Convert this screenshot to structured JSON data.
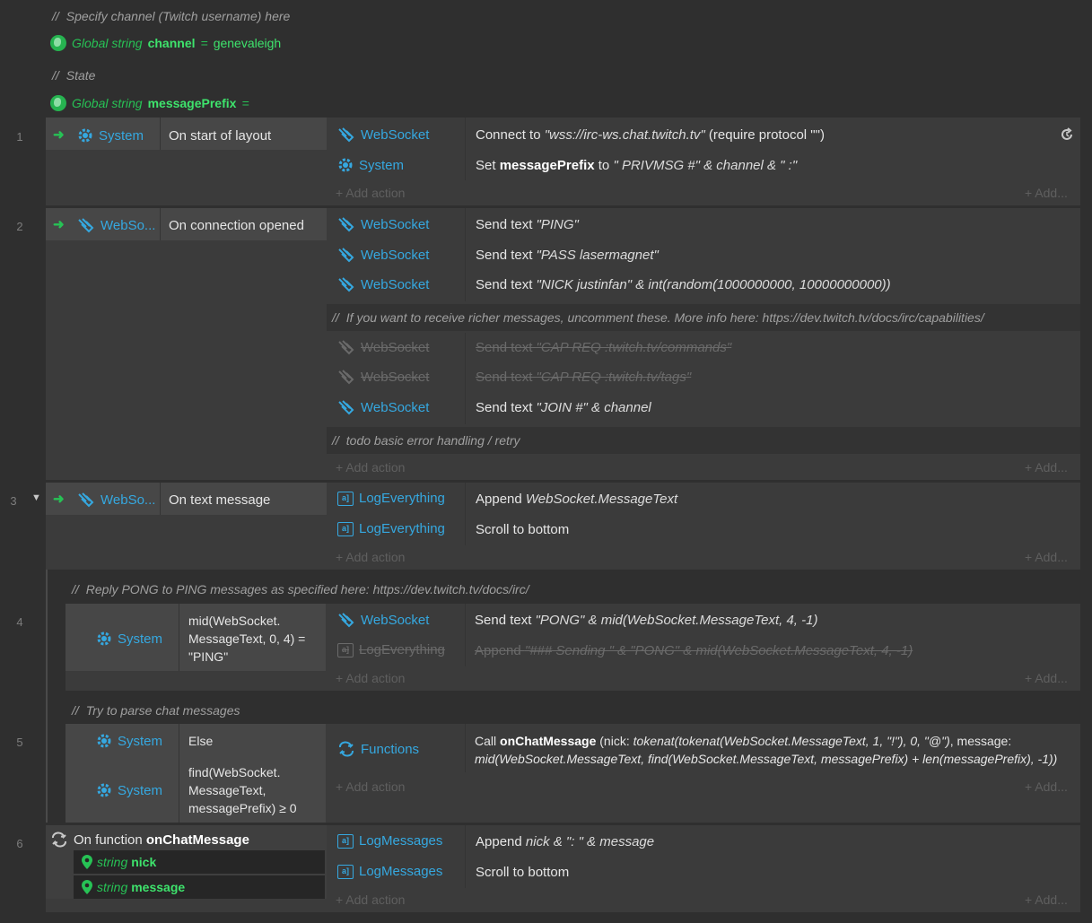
{
  "comments": {
    "channel": "Specify channel (Twitch username) here",
    "state": "State",
    "richer": "If you want to receive richer messages, uncomment these. More info here: https://dev.twitch.tv/docs/irc/capabilities/",
    "todo": "todo basic error handling / retry",
    "pong": "Reply PONG to PING messages as specified here: https://dev.twitch.tv/docs/irc/",
    "parse": "Try to parse chat messages",
    "slash": "//"
  },
  "globals": {
    "kw": "Global string",
    "channel_name": "channel",
    "channel_eq": "=",
    "channel_value": "genevaleigh",
    "prefix_name": "messagePrefix",
    "prefix_eq": "="
  },
  "line_numbers": [
    "1",
    "2",
    "3",
    "4",
    "5",
    "6"
  ],
  "add_action": "+ Add action",
  "add": "+ Add...",
  "events": {
    "e1": {
      "obj": "System",
      "cond": "On start of layout",
      "actions": [
        {
          "obj": "WebSocket",
          "pre": "Connect to ",
          "italic": "\"wss://irc-ws.chat.twitch.tv\"",
          "post": " (require protocol \"\")"
        },
        {
          "obj": "System",
          "pre": "Set ",
          "bold": "messagePrefix",
          "mid": " to ",
          "italic": "\" PRIVMSG #\" & channel & \" :\""
        }
      ]
    },
    "e2": {
      "obj": "WebSo...",
      "cond": "On connection opened",
      "actions": [
        {
          "obj": "WebSocket",
          "pre": "Send text ",
          "italic": "\"PING\""
        },
        {
          "obj": "WebSocket",
          "pre": "Send text ",
          "italic": "\"PASS lasermagnet\""
        },
        {
          "obj": "WebSocket",
          "pre": "Send text ",
          "italic": "\"NICK justinfan\" & int(random(1000000000, 10000000000))"
        },
        {
          "obj": "WebSocket",
          "pre": "Send text ",
          "italic": "\"CAP REQ :twitch.tv/commands\""
        },
        {
          "obj": "WebSocket",
          "pre": "Send text ",
          "italic": "\"CAP REQ :twitch.tv/tags\""
        },
        {
          "obj": "WebSocket",
          "pre": "Send text ",
          "italic": "\"JOIN #\" & channel"
        }
      ]
    },
    "e3": {
      "obj": "WebSo...",
      "cond": "On text message",
      "actions": [
        {
          "obj": "LogEverything",
          "pre": "Append ",
          "italic": "WebSocket.MessageText"
        },
        {
          "obj": "LogEverything",
          "pre": "Scroll to bottom"
        }
      ]
    },
    "e4": {
      "obj": "System",
      "cond_l1": "mid(WebSocket.",
      "cond_l2": "MessageText, 0, 4) =",
      "cond_l3": "\"PING\"",
      "actions": [
        {
          "obj": "WebSocket",
          "pre": "Send text ",
          "italic": "\"PONG\" & mid(WebSocket.MessageText, 4, -1)"
        },
        {
          "obj": "LogEverything",
          "pre": "Append ",
          "italic": "\"### Sending \" & \"PONG\" & mid(WebSocket.MessageText, 4, -1)"
        }
      ]
    },
    "e5": {
      "obj1": "System",
      "cond1": "Else",
      "obj2": "System",
      "cond2_l1": "find(WebSocket.",
      "cond2_l2": "MessageText,",
      "cond2_l3": "messagePrefix) ≥ 0",
      "actions": [
        {
          "obj": "Functions",
          "pre": "Call ",
          "bold": "onChatMessage",
          "mid": " (nick: ",
          "italic": "tokenat(tokenat(WebSocket.MessageText, 1, \"!\"), 0, \"@\")",
          "post": ", message:",
          "line2": "mid(WebSocket.MessageText, find(WebSocket.MessageText, messagePrefix) + len(messagePrefix), -1))"
        }
      ]
    },
    "e6": {
      "title_pre": "On function ",
      "title_bold": "onChatMessage",
      "params": [
        {
          "type": "string",
          "name": "nick"
        },
        {
          "type": "string",
          "name": "message"
        }
      ],
      "actions": [
        {
          "obj": "LogMessages",
          "pre": "Append ",
          "italic": "nick & \": \" & message"
        },
        {
          "obj": "LogMessages",
          "pre": "Scroll to bottom"
        }
      ]
    }
  },
  "colors": {
    "object": "#35a8e0",
    "trigger": "#27c255",
    "global": "#3ee36c",
    "disabled": "#6a6a6a"
  },
  "icons": [
    "globe-icon",
    "gear-icon",
    "websocket-icon",
    "log-icon",
    "functions-icon",
    "trigger-arrow-icon",
    "refresh-icon",
    "collapse-triangle-icon",
    "pin-icon"
  ]
}
